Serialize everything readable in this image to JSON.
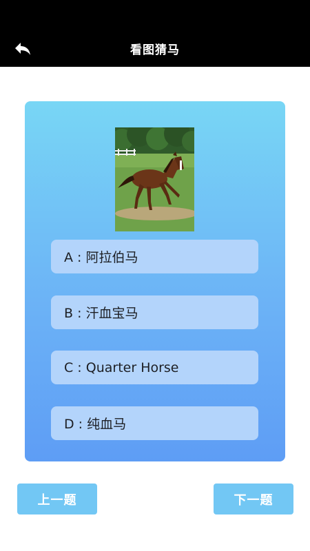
{
  "header": {
    "title": "看图猜马",
    "back_icon": "back-arrow-icon"
  },
  "question": {
    "image": "horse-photo",
    "options": [
      {
        "label": "A : 阿拉伯马"
      },
      {
        "label": "B : 汗血宝马"
      },
      {
        "label": "C : Quarter Horse"
      },
      {
        "label": "D : 纯血马"
      }
    ]
  },
  "navigation": {
    "prev_label": "上一题",
    "next_label": "下一题"
  },
  "colors": {
    "topbar": "#000000",
    "card_top": "#78d6f5",
    "card_bottom": "#5e9df5",
    "option_bg": "#b3d4fb",
    "nav_button": "#72c7f4"
  }
}
